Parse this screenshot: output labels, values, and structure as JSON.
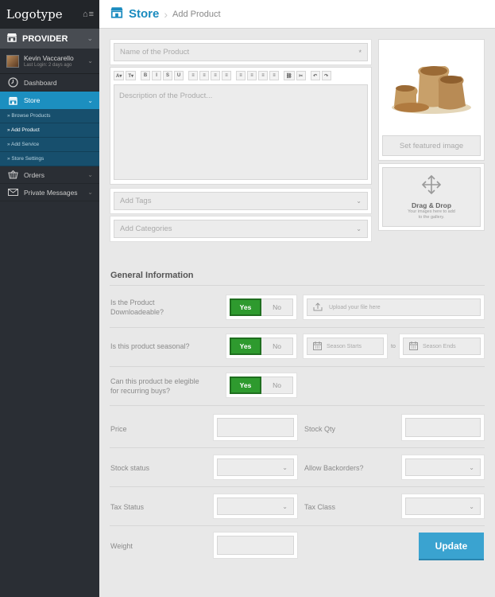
{
  "sidebar": {
    "logo": "Logotype",
    "provider_label": "PROVIDER",
    "user_name": "Kevin Vaccarello",
    "user_last_login": "Last Login: 2 days ago",
    "nav": {
      "dashboard": "Dashboard",
      "store": "Store",
      "orders": "Orders",
      "messages": "Private Messages"
    },
    "store_sub": [
      "» Browse Products",
      "» Add Product",
      "» Add Service",
      "» Store Settings"
    ]
  },
  "header": {
    "title": "Store",
    "breadcrumb": "Add Product"
  },
  "form": {
    "name_placeholder": "Name of the Product",
    "required_mark": "*",
    "toolbar": [
      "A▾",
      "T▾",
      "B",
      "I",
      "S",
      "U",
      "≡",
      "≡",
      "≡",
      "≡",
      "≡",
      "≡",
      "≡",
      "≡",
      "⛓",
      "✂",
      "↶",
      "↷"
    ],
    "description_placeholder": "Description of the Product...",
    "tags_placeholder": "Add Tags",
    "categories_placeholder": "Add Categories",
    "featured_image_label": "Set featured image",
    "drag_title": "Drag & Drop",
    "drag_sub_1": "Your images here to add",
    "drag_sub_2": "to the gallery."
  },
  "general": {
    "heading": "General Information",
    "downloadable_label_1": "Is the Product",
    "downloadable_label_2": "Downloadeable?",
    "upload_placeholder": "Upload your file here",
    "seasonal_label": "Is this product seasonal?",
    "season_starts": "Season Starts",
    "to": "to",
    "season_ends": "Season Ends",
    "recurring_label_1": "Can this product be elegible",
    "recurring_label_2": "for recurring buys?",
    "yes": "Yes",
    "no": "No",
    "price": "Price",
    "stock_qty": "Stock Qty",
    "stock_status": "Stock status",
    "allow_backorders": "Allow Backorders?",
    "tax_status": "Tax Status",
    "tax_class": "Tax Class",
    "weight": "Weight",
    "update_button": "Update"
  },
  "colors": {
    "accent": "#1a8bbf",
    "sidebar": "#2a2e34",
    "toggle_yes": "#2e9a2e",
    "update": "#3aa3d0"
  }
}
